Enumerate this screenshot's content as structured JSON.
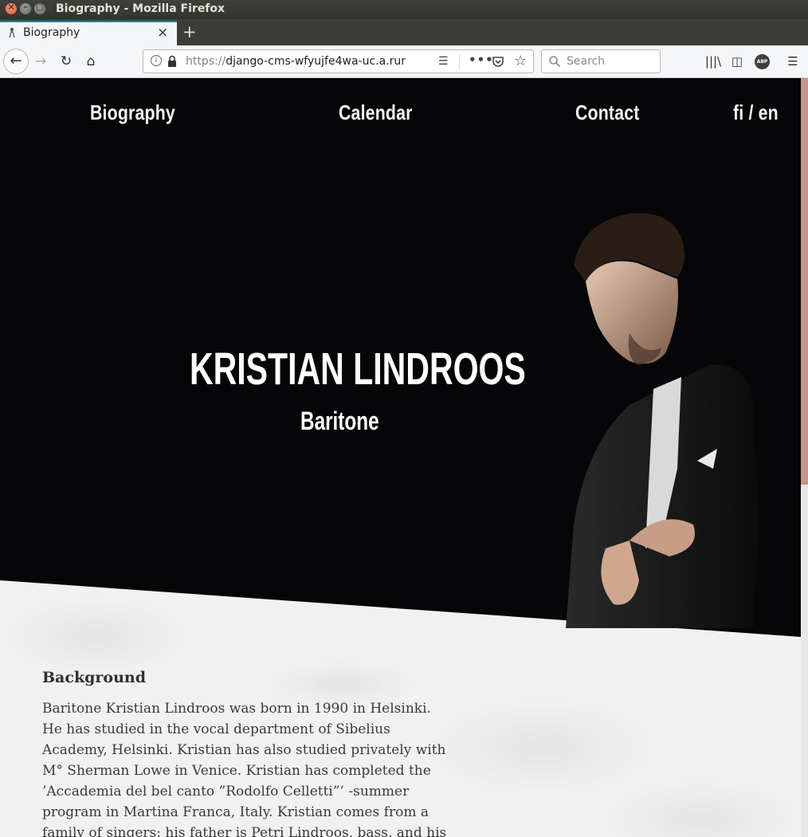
{
  "window": {
    "title": "Biography - Mozilla Firefox",
    "close_glyph": "×",
    "min_glyph": "–",
    "max_glyph": "▢"
  },
  "tabs": [
    {
      "label": "Biography",
      "favicon": "person-icon",
      "close_glyph": "×"
    }
  ],
  "new_tab_glyph": "+",
  "navbar": {
    "back_glyph": "←",
    "forward_glyph": "→",
    "reload_glyph": "↻",
    "home_glyph": "⌂",
    "url_protocol": "https://",
    "url_host": "django-cms-wfyujfe4wa-uc.a.run",
    "reader_glyph": "☰",
    "page_actions_glyph": "•••",
    "bookmark_glyph": "☆",
    "search_placeholder": "Search",
    "library_glyph": "|||\\",
    "sidebar_glyph": "◫",
    "abp_label": "ABP",
    "menu_glyph": "☰"
  },
  "site_nav": {
    "biography": "Biography",
    "calendar": "Calendar",
    "contact": "Contact",
    "language": "fi / en"
  },
  "hero": {
    "name": "KRISTIAN LINDROOS",
    "subtitle": "Baritone"
  },
  "content": {
    "section_title": "Background",
    "bio": "Baritone Kristian Lindroos was born in 1990 in Helsinki. He has studied in the vocal department of Sibelius Academy, Helsinki. Kristian has also studied privately with M° Sherman Lowe in Venice. Kristian has completed the ’Accademia del bel canto ”Rodolfo Celletti”’ -summer program in Martina Franca, Italy. Kristian comes from a family of singers: his father is Petri Lindroos, bass, and his"
  },
  "colors": {
    "hero_bg": "#060608",
    "page_bg": "#f0f0f0",
    "scroll_thumb": "#c7958c",
    "tab_accent": "#0a84ff"
  }
}
